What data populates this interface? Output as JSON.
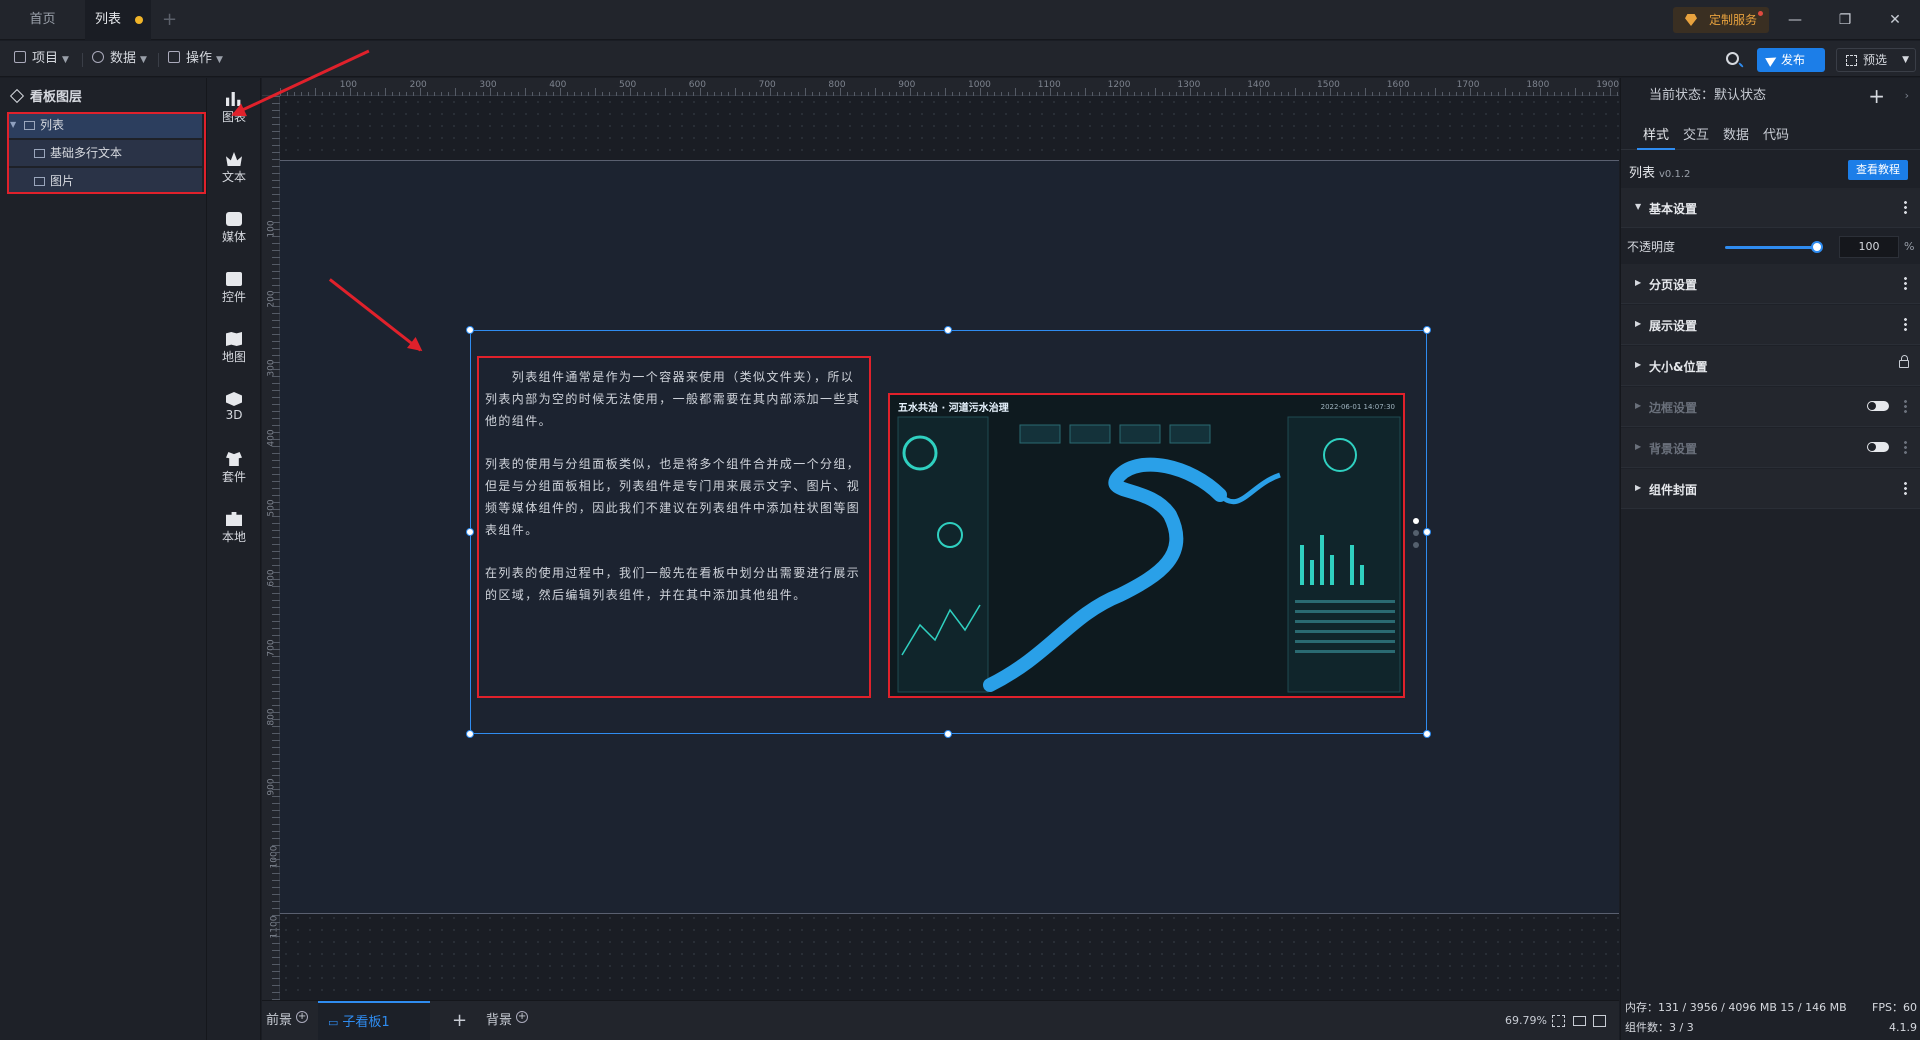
{
  "tabs": {
    "home": "首页",
    "active": "列表",
    "add": "+"
  },
  "custom_service": "定制服务",
  "window": {
    "minimize": "—",
    "restore": "❐",
    "close": "✕"
  },
  "menu": {
    "project": "项目",
    "data": "数据",
    "operate": "操作",
    "publish": "发布",
    "preview": "预选"
  },
  "layers": {
    "title": "看板图层",
    "items": [
      {
        "label": "列表"
      },
      {
        "label": "基础多行文本"
      },
      {
        "label": "图片"
      }
    ]
  },
  "components": [
    {
      "label": "图表",
      "icon": "chart-icon"
    },
    {
      "label": "文本",
      "icon": "text-icon"
    },
    {
      "label": "媒体",
      "icon": "media-icon"
    },
    {
      "label": "控件",
      "icon": "control-icon"
    },
    {
      "label": "地图",
      "icon": "map-icon"
    },
    {
      "label": "3D",
      "icon": "cube-icon"
    },
    {
      "label": "套件",
      "icon": "suite-icon"
    },
    {
      "label": "本地",
      "icon": "puzzle-icon"
    }
  ],
  "ruler": {
    "h": [
      "100",
      "200",
      "300",
      "400",
      "500",
      "600",
      "700",
      "800",
      "900",
      "1000",
      "1100",
      "1200",
      "1300",
      "1400",
      "1500",
      "1600",
      "1700",
      "1800",
      "1900"
    ],
    "v": [
      "100",
      "200",
      "300",
      "400",
      "500",
      "600",
      "700",
      "800",
      "900",
      "1000",
      "1100"
    ]
  },
  "text_widget": {
    "paragraphs": [
      "　　列表组件通常是作为一个容器来使用（类似文件夹），所以列表内部为空的时候无法使用，一般都需要在其内部添加一些其他的组件。",
      "列表的使用与分组面板类似，也是将多个组件合并成一个分组，但是与分组面板相比，列表组件是专门用来展示文字、图片、视频等媒体组件的，因此我们不建议在列表组件中添加柱状图等图表组件。",
      "在列表的使用过程中，我们一般先在看板中划分出需要进行展示的区域，然后编辑列表组件，并在其中添加其他组件。"
    ]
  },
  "image_widget": {
    "title": "五水共治 · 河道污水治理",
    "time": "2022-06-01 14:07:30"
  },
  "bottom": {
    "foreground": "前景",
    "sub_board": "子看板1",
    "add": "+",
    "background": "背景",
    "zoom": "69.79%"
  },
  "right_panel": {
    "state": "当前状态：默认状态",
    "tabs": [
      "样式",
      "交互",
      "数据",
      "代码"
    ],
    "component_name": "列表",
    "version": "v0.1.2",
    "tutorial": "查看教程",
    "sections": {
      "basic": "基本设置",
      "paging": "分页设置",
      "display": "展示设置",
      "size_pos": "大小&位置",
      "border": "边框设置",
      "background": "背景设置",
      "cover": "组件封面"
    },
    "opacity_label": "不透明度",
    "opacity_value": "100",
    "opacity_unit": "%",
    "stats": {
      "memory": "内存：131 / 3956 / 4096 MB 15 / 146 MB",
      "fps": "FPS：60",
      "count": "组件数：3 / 3",
      "version": "4.1.9"
    }
  },
  "colors": {
    "accent": "#2f8cf0",
    "annotation": "#e0212b",
    "brand_button": "#1c7ee8"
  }
}
